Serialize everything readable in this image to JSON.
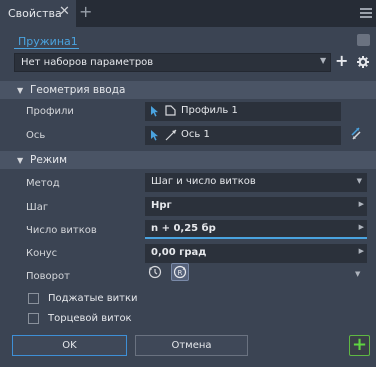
{
  "titlebar": {
    "tab_label": "Свойства",
    "close_glyph": "✕",
    "add_glyph": "+"
  },
  "feature": {
    "name": "Пружина1"
  },
  "preset": {
    "value": "Нет наборов параметров",
    "plus_glyph": "+",
    "gear_glyph": "✱"
  },
  "input_geometry": {
    "title": "Геометрия ввода",
    "profiles_label": "Профили",
    "profiles_value": "Профиль 1",
    "axis_label": "Ось",
    "axis_value": "Ось 1"
  },
  "mode": {
    "title": "Режим",
    "method_label": "Метод",
    "method_value": "Шаг и число витков",
    "pitch_label": "Шаг",
    "pitch_value": "Hрг",
    "turns_label": "Число витков",
    "turns_value": "n + 0,25 бр",
    "taper_label": "Конус",
    "taper_value": "0,00 град",
    "rotation_label": "Поворот"
  },
  "options": {
    "closed_ends_label": "Поджатые витки",
    "ground_ends_label": "Торцевой виток",
    "closed_ends_checked": false,
    "ground_ends_checked": false
  },
  "buttons": {
    "ok": "OK",
    "cancel": "Отмена",
    "apply_glyph": "+"
  },
  "colors": {
    "panel_bg": "#3b4453",
    "accent_blue": "#4aa3df",
    "apply_green": "#5fd441"
  }
}
